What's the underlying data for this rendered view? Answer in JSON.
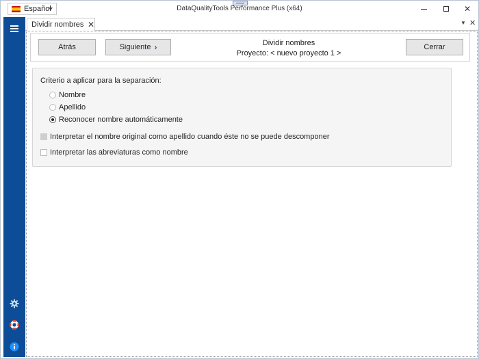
{
  "window": {
    "title": "DataQualityTools Performance Plus (x64)",
    "language": "Español",
    "controls": {
      "minimize": "minimize-icon",
      "maximize": "maximize-icon",
      "close": "✕"
    }
  },
  "rail": {
    "accent": "#0d4d97",
    "icons": [
      "menu-icon",
      "gear-icon",
      "lifering-icon",
      "info-icon"
    ]
  },
  "tabs": [
    {
      "label": "Dividir nombres",
      "close": "✕"
    }
  ],
  "tabstrip": {
    "dropdown": "▼",
    "close": "✕"
  },
  "nav": {
    "back_label": "Atrás",
    "next_label": "Siguiente",
    "next_chevron": "›",
    "title": "Dividir nombres",
    "project": "Proyecto: < nuevo proyecto 1 >",
    "close_label": "Cerrar"
  },
  "options": {
    "criteria_label": "Criterio a aplicar para la separación:",
    "radios": [
      {
        "label": "Nombre",
        "checked": false
      },
      {
        "label": "Apellido",
        "checked": false
      },
      {
        "label": "Reconocer nombre automáticamente",
        "checked": true
      }
    ],
    "checkboxes": [
      {
        "label": "Interpretar el nombre original como apellido cuando éste no se puede descomponer",
        "checked": false,
        "disabled": true
      },
      {
        "label": "Interpretar las abreviaturas como nombre",
        "checked": false,
        "disabled": false
      }
    ]
  }
}
